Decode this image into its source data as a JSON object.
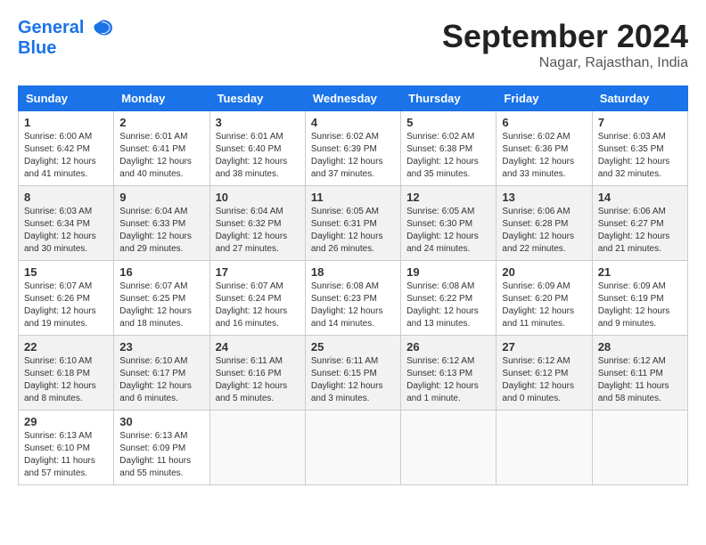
{
  "header": {
    "logo_line1": "General",
    "logo_line2": "Blue",
    "month_title": "September 2024",
    "location": "Nagar, Rajasthan, India"
  },
  "weekdays": [
    "Sunday",
    "Monday",
    "Tuesday",
    "Wednesday",
    "Thursday",
    "Friday",
    "Saturday"
  ],
  "weeks": [
    [
      {
        "day": "1",
        "sunrise": "6:00 AM",
        "sunset": "6:42 PM",
        "daylight": "12 hours and 41 minutes."
      },
      {
        "day": "2",
        "sunrise": "6:01 AM",
        "sunset": "6:41 PM",
        "daylight": "12 hours and 40 minutes."
      },
      {
        "day": "3",
        "sunrise": "6:01 AM",
        "sunset": "6:40 PM",
        "daylight": "12 hours and 38 minutes."
      },
      {
        "day": "4",
        "sunrise": "6:02 AM",
        "sunset": "6:39 PM",
        "daylight": "12 hours and 37 minutes."
      },
      {
        "day": "5",
        "sunrise": "6:02 AM",
        "sunset": "6:38 PM",
        "daylight": "12 hours and 35 minutes."
      },
      {
        "day": "6",
        "sunrise": "6:02 AM",
        "sunset": "6:36 PM",
        "daylight": "12 hours and 33 minutes."
      },
      {
        "day": "7",
        "sunrise": "6:03 AM",
        "sunset": "6:35 PM",
        "daylight": "12 hours and 32 minutes."
      }
    ],
    [
      {
        "day": "8",
        "sunrise": "6:03 AM",
        "sunset": "6:34 PM",
        "daylight": "12 hours and 30 minutes."
      },
      {
        "day": "9",
        "sunrise": "6:04 AM",
        "sunset": "6:33 PM",
        "daylight": "12 hours and 29 minutes."
      },
      {
        "day": "10",
        "sunrise": "6:04 AM",
        "sunset": "6:32 PM",
        "daylight": "12 hours and 27 minutes."
      },
      {
        "day": "11",
        "sunrise": "6:05 AM",
        "sunset": "6:31 PM",
        "daylight": "12 hours and 26 minutes."
      },
      {
        "day": "12",
        "sunrise": "6:05 AM",
        "sunset": "6:30 PM",
        "daylight": "12 hours and 24 minutes."
      },
      {
        "day": "13",
        "sunrise": "6:06 AM",
        "sunset": "6:28 PM",
        "daylight": "12 hours and 22 minutes."
      },
      {
        "day": "14",
        "sunrise": "6:06 AM",
        "sunset": "6:27 PM",
        "daylight": "12 hours and 21 minutes."
      }
    ],
    [
      {
        "day": "15",
        "sunrise": "6:07 AM",
        "sunset": "6:26 PM",
        "daylight": "12 hours and 19 minutes."
      },
      {
        "day": "16",
        "sunrise": "6:07 AM",
        "sunset": "6:25 PM",
        "daylight": "12 hours and 18 minutes."
      },
      {
        "day": "17",
        "sunrise": "6:07 AM",
        "sunset": "6:24 PM",
        "daylight": "12 hours and 16 minutes."
      },
      {
        "day": "18",
        "sunrise": "6:08 AM",
        "sunset": "6:23 PM",
        "daylight": "12 hours and 14 minutes."
      },
      {
        "day": "19",
        "sunrise": "6:08 AM",
        "sunset": "6:22 PM",
        "daylight": "12 hours and 13 minutes."
      },
      {
        "day": "20",
        "sunrise": "6:09 AM",
        "sunset": "6:20 PM",
        "daylight": "12 hours and 11 minutes."
      },
      {
        "day": "21",
        "sunrise": "6:09 AM",
        "sunset": "6:19 PM",
        "daylight": "12 hours and 9 minutes."
      }
    ],
    [
      {
        "day": "22",
        "sunrise": "6:10 AM",
        "sunset": "6:18 PM",
        "daylight": "12 hours and 8 minutes."
      },
      {
        "day": "23",
        "sunrise": "6:10 AM",
        "sunset": "6:17 PM",
        "daylight": "12 hours and 6 minutes."
      },
      {
        "day": "24",
        "sunrise": "6:11 AM",
        "sunset": "6:16 PM",
        "daylight": "12 hours and 5 minutes."
      },
      {
        "day": "25",
        "sunrise": "6:11 AM",
        "sunset": "6:15 PM",
        "daylight": "12 hours and 3 minutes."
      },
      {
        "day": "26",
        "sunrise": "6:12 AM",
        "sunset": "6:13 PM",
        "daylight": "12 hours and 1 minute."
      },
      {
        "day": "27",
        "sunrise": "6:12 AM",
        "sunset": "6:12 PM",
        "daylight": "12 hours and 0 minutes."
      },
      {
        "day": "28",
        "sunrise": "6:12 AM",
        "sunset": "6:11 PM",
        "daylight": "11 hours and 58 minutes."
      }
    ],
    [
      {
        "day": "29",
        "sunrise": "6:13 AM",
        "sunset": "6:10 PM",
        "daylight": "11 hours and 57 minutes."
      },
      {
        "day": "30",
        "sunrise": "6:13 AM",
        "sunset": "6:09 PM",
        "daylight": "11 hours and 55 minutes."
      },
      null,
      null,
      null,
      null,
      null
    ]
  ]
}
